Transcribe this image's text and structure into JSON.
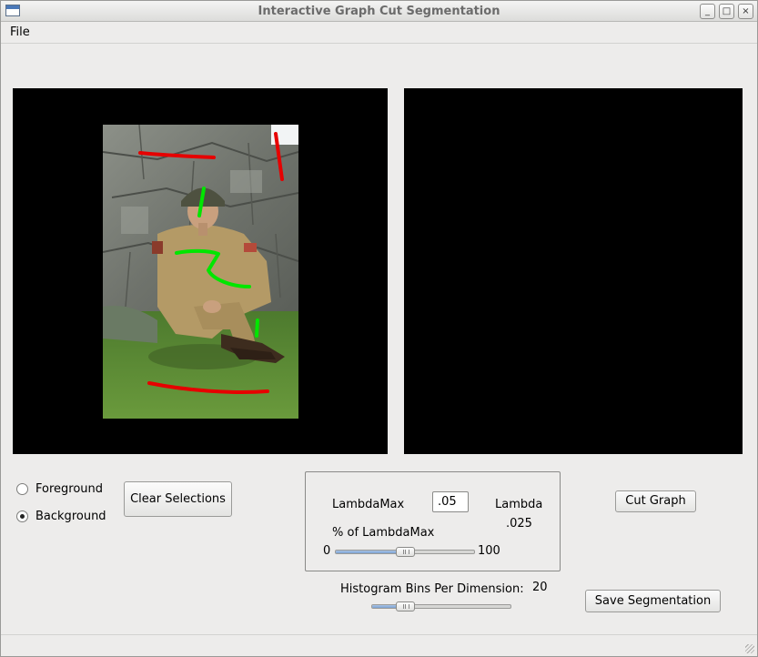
{
  "window": {
    "title": "Interactive Graph Cut Segmentation"
  },
  "window_controls": {
    "minimize": "_",
    "maximize": "□",
    "close": "×"
  },
  "menu": {
    "file": "File"
  },
  "selection_mode": {
    "options": [
      {
        "label": "Foreground",
        "checked": false
      },
      {
        "label": "Background",
        "checked": true
      }
    ]
  },
  "buttons": {
    "clear_selections": "Clear Selections",
    "cut_graph": "Cut Graph",
    "save_segmentation": "Save Segmentation"
  },
  "lambda_panel": {
    "lambda_max_label": "LambdaMax",
    "lambda_max_value": ".05",
    "lambda_label": "Lambda",
    "lambda_value": ".025",
    "percent_label": "% of LambdaMax",
    "slider_min": "0",
    "slider_max": "100",
    "slider_percent": 50
  },
  "histogram": {
    "label": "Histogram Bins Per Dimension:",
    "value": "20",
    "slider_fraction": 0.24
  },
  "colors": {
    "foreground_stroke": "#00e600",
    "background_stroke": "#e60000",
    "slider_fill": "#8fb2dc"
  }
}
